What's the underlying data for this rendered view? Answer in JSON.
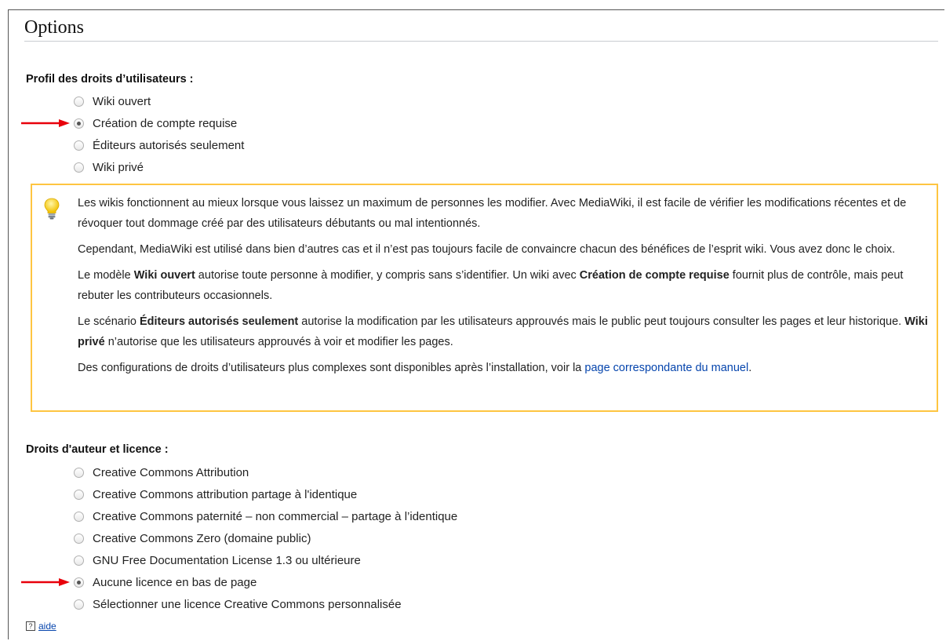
{
  "page": {
    "title": "Options"
  },
  "rights_profile": {
    "label": "Profil des droits d’utilisateurs :",
    "options": [
      {
        "label": "Wiki ouvert",
        "checked": false
      },
      {
        "label": "Création de compte requise",
        "checked": true
      },
      {
        "label": "Éditeurs autorisés seulement",
        "checked": false
      },
      {
        "label": "Wiki privé",
        "checked": false
      }
    ]
  },
  "help_box": {
    "p1": "Les wikis fonctionnent au mieux lorsque vous laissez un maximum de personnes les modifier. Avec MediaWiki, il est facile de vérifier les modifications récentes et de révoquer tout dommage créé par des utilisateurs débutants ou mal intentionnés.",
    "p2": "Cependant, MediaWiki est utilisé dans bien d’autres cas et il n’est pas toujours facile de convaincre chacun des bénéfices de l’esprit wiki. Vous avez donc le choix.",
    "p3": {
      "t1": "Le modèle ",
      "b1": "Wiki ouvert",
      "t2": " autorise toute personne à modifier, y compris sans s’identifier. Un wiki avec ",
      "b2": "Création de compte requise",
      "t3": " fournit plus de contrôle, mais peut rebuter les contributeurs occasionnels."
    },
    "p4": {
      "t1": "Le scénario ",
      "b1": "Éditeurs autorisés seulement",
      "t2": " autorise la modification par les utilisateurs approuvés mais le public peut toujours consulter les pages et leur historique. ",
      "b2": "Wiki privé",
      "t3": " n’autorise que les utilisateurs approuvés à voir et modifier les pages."
    },
    "p5": {
      "t1": "Des configurations de droits d’utilisateurs plus complexes sont disponibles après l’installation, voir la ",
      "link": "page correspondante du manuel",
      "t2": "."
    }
  },
  "license": {
    "label": "Droits d'auteur et licence :",
    "options": [
      {
        "label": "Creative Commons Attribution",
        "checked": false
      },
      {
        "label": "Creative Commons attribution partage à l'identique",
        "checked": false
      },
      {
        "label": "Creative Commons paternité – non commercial – partage à l’identique",
        "checked": false
      },
      {
        "label": "Creative Commons Zero (domaine public)",
        "checked": false
      },
      {
        "label": "GNU Free Documentation License 1.3 ou ultérieure",
        "checked": false
      },
      {
        "label": "Aucune licence en bas de page",
        "checked": true
      },
      {
        "label": "Sélectionner une licence Creative Commons personnalisée",
        "checked": false
      }
    ]
  },
  "help_link": {
    "icon_glyph": "?",
    "label": "aide"
  },
  "icons": {
    "bulb": "lightbulb-icon",
    "arrow": "red-arrow-icon"
  },
  "colors": {
    "arrow": "#e8000b",
    "box_border": "#fec541",
    "link": "#0645ad"
  }
}
